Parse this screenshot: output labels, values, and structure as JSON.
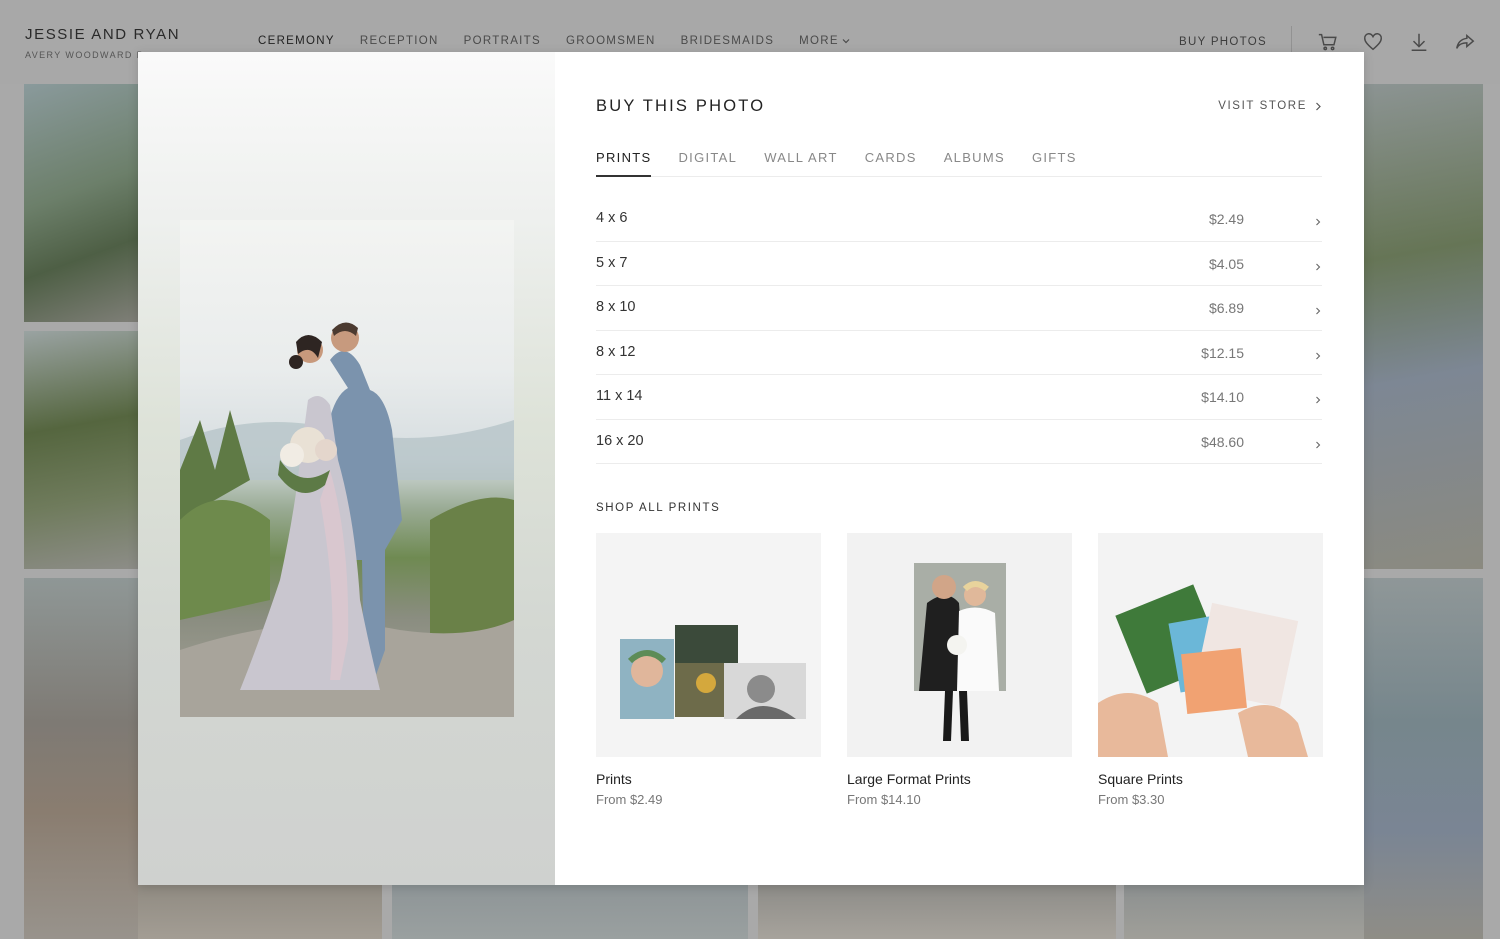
{
  "header": {
    "title": "JESSIE AND RYAN",
    "subtitle": "AVERY WOODWARD P",
    "nav": [
      "CEREMONY",
      "RECEPTION",
      "PORTRAITS",
      "GROOMSMEN",
      "BRIDESMAIDS"
    ],
    "nav_more": "MORE",
    "buy_photos": "BUY PHOTOS",
    "icons": [
      "cart-icon",
      "heart-icon",
      "download-icon",
      "share-icon"
    ]
  },
  "modal": {
    "title": "BUY THIS PHOTO",
    "visit_store": "VISIT STORE",
    "tabs": [
      "PRINTS",
      "DIGITAL",
      "WALL ART",
      "CARDS",
      "ALBUMS",
      "GIFTS"
    ],
    "active_tab": "PRINTS",
    "prices": [
      {
        "size": "4 x 6",
        "price": "$2.49"
      },
      {
        "size": "5 x 7",
        "price": "$4.05"
      },
      {
        "size": "8 x 10",
        "price": "$6.89"
      },
      {
        "size": "8 x 12",
        "price": "$12.15"
      },
      {
        "size": "11 x 14",
        "price": "$14.10"
      },
      {
        "size": "16 x 20",
        "price": "$48.60"
      }
    ],
    "shop_all": "SHOP ALL PRINTS",
    "products": [
      {
        "name": "Prints",
        "price": "From $2.49"
      },
      {
        "name": "Large Format Prints",
        "price": "From $14.10"
      },
      {
        "name": "Square Prints",
        "price": "From $3.30"
      }
    ]
  },
  "colors": {
    "accent": "#222222",
    "muted": "#777777",
    "divider": "#ececec",
    "overlay": "#a9a9a9"
  }
}
